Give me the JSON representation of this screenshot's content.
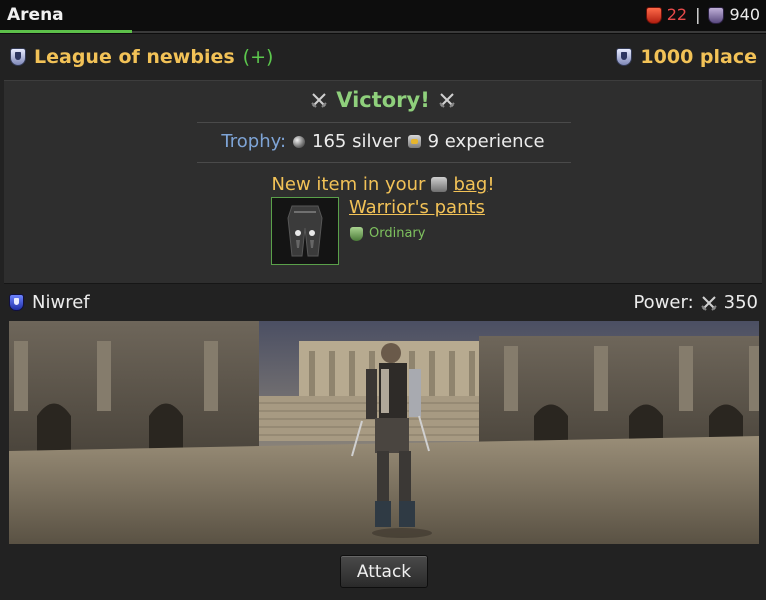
{
  "header": {
    "title": "Arena",
    "red_count": "22",
    "separator": "|",
    "purple_count": "940",
    "red_icon": "red-badge-icon",
    "purple_icon": "purple-shield-icon",
    "accent": "#5dc04a"
  },
  "league": {
    "name": "League of newbies",
    "plus": "(+)",
    "place": "1000 place",
    "icon": "league-shield-icon"
  },
  "result": {
    "title": "Victory!",
    "trophy_label": "Trophy:",
    "silver": "165 silver",
    "experience": "9 experience",
    "new_item_prefix": "New item in your",
    "bag_link": "bag",
    "new_item_suffix": "!",
    "item_name": "Warrior's pants",
    "item_rarity": "Ordinary"
  },
  "opponent": {
    "name": "Niwref",
    "power_label": "Power:",
    "power_value": "350"
  },
  "actions": {
    "attack_label": "Attack"
  },
  "colors": {
    "gold": "#f2c257",
    "green": "#8fd07c",
    "blue": "#7ea4d6",
    "background": "#222222"
  }
}
